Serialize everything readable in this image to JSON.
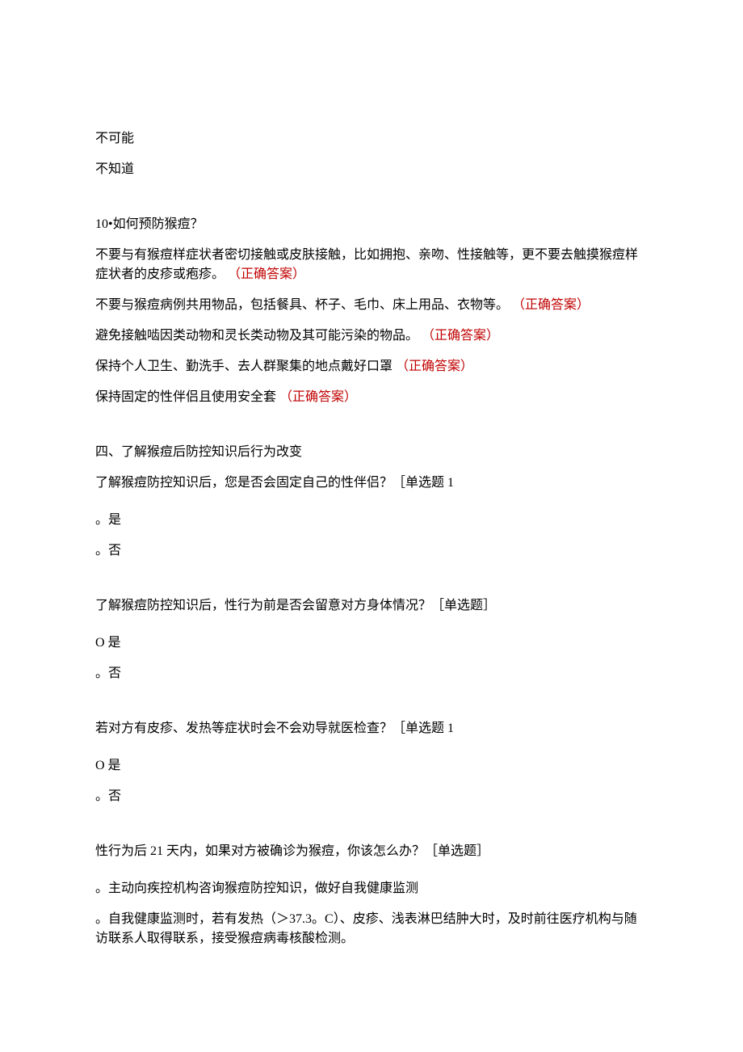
{
  "intro": {
    "opt1": "不可能",
    "opt2": "不知道"
  },
  "q10": {
    "title": "10•如何预防猴痘？",
    "a1_text": "不要与有猴痘样症状者密切接触或皮肤接触，比如拥抱、亲吻、性接触等，更不要去触摸猴痘样症状者的皮疹或疱疹。",
    "a1_mark_open": "（正确",
    "a1_mark_bold": "答案）",
    "a2_text": "不要与猴痘病例共用物品，包括餐具、杯子、毛巾、床上用品、衣物等。",
    "a2_mark_open": "（正确",
    "a2_mark_bold": "答案）",
    "a3_text": "避免接触啮因类动物和灵长类动物及其可能污染的物品。",
    "a3_mark_open": "（正确",
    "a3_mark_bold": "答案）",
    "a4_text": "保持个人卫生、勤洗手、去人群聚集的地点戴好口罩",
    "a4_mark_open": "（正确",
    "a4_mark_bold": "答案）",
    "a5_text": "保持固定的性伴侣且使用安全套",
    "a5_mark_open": "（正确",
    "a5_mark_bold": "答案）"
  },
  "section4": {
    "heading": "四、了解猴痘后防控知识后行为改变",
    "q1": {
      "title": "了解猴痘防控知识后，您是否会固定自己的性伴侣？［单选题 1",
      "opt1": "。是",
      "opt2": "。否"
    },
    "q2": {
      "title": "了解猴痘防控知识后，性行为前是否会留意对方身体情况？［单选题］",
      "opt1": "O 是",
      "opt2": "。否"
    },
    "q3": {
      "title": "若对方有皮疹、发热等症状时会不会劝导就医检查？［单选题 1",
      "opt1": "O 是",
      "opt2": "。否"
    },
    "q4": {
      "title": "性行为后 21 天内，如果对方被确诊为猴痘，你该怎么办？［单选题］",
      "opt1": "。主动向疾控机构咨询猴痘防控知识，做好自我健康监测",
      "opt2_a": "。自",
      "opt2_b": "我健康",
      "opt2_c": "监测时，若有发热（＞37.3。C）、皮疹、浅表淋巴结肿大时，及时前往医疗机构与随访联系人取得联系，接受猴痘病毒核酸检测。"
    }
  }
}
